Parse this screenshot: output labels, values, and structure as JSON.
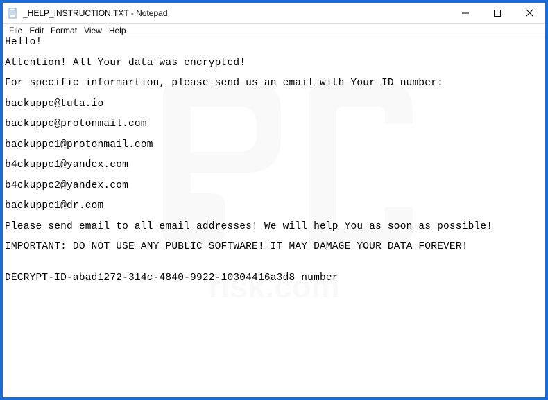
{
  "window": {
    "title": "_HELP_INSTRUCTION.TXT - Notepad"
  },
  "menu": {
    "file": "File",
    "edit": "Edit",
    "format": "Format",
    "view": "View",
    "help": "Help"
  },
  "document": {
    "lines": [
      "Hello!",
      "",
      "Attention! All Your data was encrypted!",
      "",
      "For specific informartion, please send us an email with Your ID number:",
      "",
      "backuppc@tuta.io",
      "",
      "backuppc@protonmail.com",
      "",
      "backuppc1@protonmail.com",
      "",
      "b4ckuppc1@yandex.com",
      "",
      "b4ckuppc2@yandex.com",
      "",
      "backuppc1@dr.com",
      "",
      "Please send email to all email addresses! We will help You as soon as possible!",
      "",
      "IMPORTANT: DO NOT USE ANY PUBLIC SOFTWARE! IT MAY DAMAGE YOUR DATA FOREVER!",
      "",
      "",
      "DECRYPT-ID-abad1272-314c-4840-9922-10304416a3d8 number"
    ]
  },
  "watermark": {
    "text": "pcrisk.com"
  }
}
